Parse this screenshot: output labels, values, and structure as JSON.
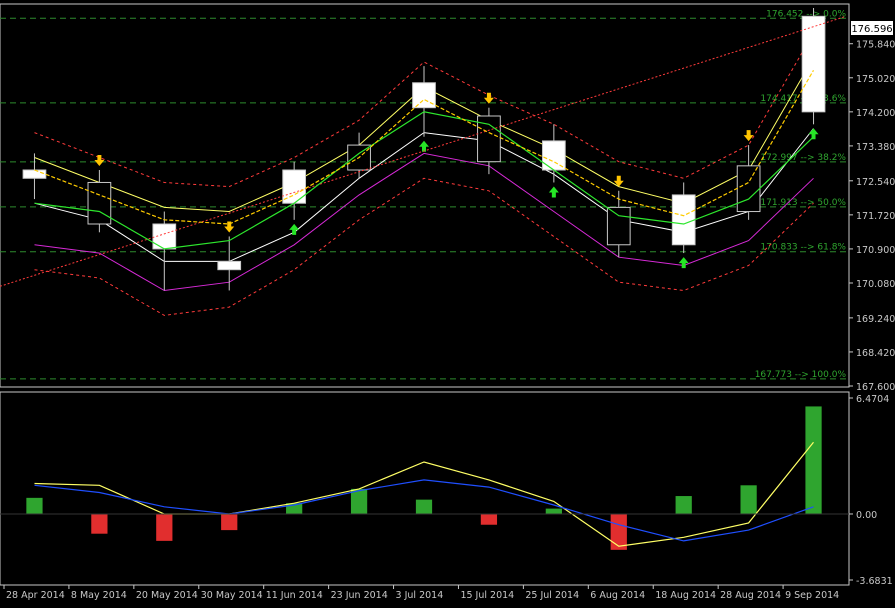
{
  "colors": {
    "background": "#000000",
    "axis": "#c8c8c8",
    "grid": "#2e8b2e",
    "fib_text": "#2fa52f",
    "candle_bull": "#ffffff",
    "candle_bear": "#000000",
    "candle_wick": "#c8c8c8",
    "bands_outer": "#ff3b3b",
    "bands_inner": "#ffff66",
    "ma_white": "#ffffff",
    "ma_magenta": "#d62ad6",
    "trend_green": "#2de62d",
    "trend_yellow": "#ffcc00",
    "arrow_up": "#26e626",
    "arrow_down": "#ffc400",
    "macd_pos": "#2fa52f",
    "macd_neg": "#e12e2e",
    "macd_signal": "#ffff66",
    "macd_main": "#1f4fff",
    "price_label_bg": "#ffffff",
    "price_label_fg": "#000000"
  },
  "price_panel": {
    "current_price": "176.596",
    "y_ticks": [
      "175.840",
      "175.020",
      "174.200",
      "173.380",
      "172.540",
      "171.720",
      "170.900",
      "170.080",
      "169.240",
      "168.420",
      "167.600"
    ],
    "fib_levels": [
      {
        "label": "176.452 --> 0.0%",
        "price": 176.452
      },
      {
        "label": "174.417 --> 23.6%",
        "price": 174.417
      },
      {
        "label": "172.997 --> 38.2%",
        "price": 172.997
      },
      {
        "label": "171.913 --> 50.0%",
        "price": 171.913
      },
      {
        "label": "170.833 --> 61.8%",
        "price": 170.833
      },
      {
        "label": "167.773 --> 100.0%",
        "price": 167.773
      }
    ]
  },
  "indicator_panel": {
    "y_ticks": [
      "6.4704",
      "0.00",
      "-3.6831"
    ]
  },
  "x_axis_labels": [
    "28 Apr 2014",
    "8 May 2014",
    "20 May 2014",
    "30 May 2014",
    "11 Jun 2014",
    "23 Jun 2014",
    "3 Jul 2014",
    "15 Jul 2014",
    "25 Jul 2014",
    "6 Aug 2014",
    "18 Aug 2014",
    "28 Aug 2014",
    "9 Sep 2014"
  ],
  "chart_data": [
    {
      "type": "line",
      "chart_style": "candlestick",
      "x_labels": [
        "28 Apr 2014",
        "8 May 2014",
        "20 May 2014",
        "30 May 2014",
        "11 Jun 2014",
        "23 Jun 2014",
        "3 Jul 2014",
        "15 Jul 2014",
        "25 Jul 2014",
        "6 Aug 2014",
        "18 Aug 2014",
        "28 Aug 2014",
        "9 Sep 2014"
      ],
      "ylim": [
        167.6,
        176.7
      ],
      "candles": [
        {
          "x": "28 Apr 2014",
          "o": 172.6,
          "h": 173.2,
          "l": 172.1,
          "c": 172.8
        },
        {
          "x": "8 May 2014",
          "o": 172.5,
          "h": 172.8,
          "l": 171.3,
          "c": 171.5
        },
        {
          "x": "20 May 2014",
          "o": 170.9,
          "h": 171.8,
          "l": 169.9,
          "c": 171.5
        },
        {
          "x": "30 May 2014",
          "o": 170.4,
          "h": 171.2,
          "l": 169.9,
          "c": 170.6
        },
        {
          "x": "11 Jun 2014",
          "o": 172.0,
          "h": 173.0,
          "l": 171.6,
          "c": 172.8
        },
        {
          "x": "23 Jun 2014",
          "o": 173.4,
          "h": 173.7,
          "l": 172.6,
          "c": 172.8
        },
        {
          "x": "3 Jul 2014",
          "o": 174.3,
          "h": 175.3,
          "l": 173.6,
          "c": 174.9
        },
        {
          "x": "15 Jul 2014",
          "o": 174.1,
          "h": 174.3,
          "l": 172.7,
          "c": 173.0
        },
        {
          "x": "25 Jul 2014",
          "o": 172.8,
          "h": 173.9,
          "l": 172.5,
          "c": 173.5
        },
        {
          "x": "6 Aug 2014",
          "o": 171.9,
          "h": 172.3,
          "l": 170.7,
          "c": 171.0
        },
        {
          "x": "18 Aug 2014",
          "o": 171.0,
          "h": 172.5,
          "l": 170.8,
          "c": 172.2
        },
        {
          "x": "28 Aug 2014",
          "o": 172.9,
          "h": 173.4,
          "l": 171.6,
          "c": 171.8
        },
        {
          "x": "9 Sep 2014",
          "o": 174.2,
          "h": 176.7,
          "l": 173.9,
          "c": 176.5
        }
      ],
      "series": [
        {
          "values": [
            173.1,
            172.5,
            171.9,
            171.8,
            172.5,
            173.4,
            174.8,
            174.0,
            173.3,
            172.4,
            172.0,
            172.8,
            175.5
          ]
        },
        {
          "values": [
            172.0,
            171.6,
            170.6,
            170.6,
            171.3,
            172.6,
            173.7,
            173.5,
            172.7,
            171.6,
            171.3,
            171.8,
            173.8
          ]
        },
        {
          "values": [
            171.0,
            170.8,
            169.9,
            170.1,
            171.0,
            172.2,
            173.2,
            172.9,
            171.8,
            170.7,
            170.5,
            171.1,
            172.6
          ]
        }
      ]
    },
    {
      "type": "bar",
      "x_labels": [
        "28 Apr 2014",
        "8 May 2014",
        "20 May 2014",
        "30 May 2014",
        "11 Jun 2014",
        "23 Jun 2014",
        "3 Jul 2014",
        "15 Jul 2014",
        "25 Jul 2014",
        "6 Aug 2014",
        "18 Aug 2014",
        "28 Aug 2014",
        "9 Sep 2014"
      ],
      "ylim": [
        -3.6831,
        6.4704
      ],
      "series": [
        {
          "name": "histogram",
          "values": [
            0.9,
            -1.1,
            -1.5,
            -0.9,
            0.6,
            1.4,
            0.8,
            -0.6,
            0.3,
            -2.0,
            1.0,
            1.6,
            6.0
          ]
        },
        {
          "name": "signal",
          "values": [
            1.7,
            1.6,
            0.0,
            0.0,
            0.6,
            1.4,
            2.9,
            1.9,
            0.7,
            -1.8,
            -1.3,
            -0.5,
            4.0
          ]
        },
        {
          "name": "main",
          "values": [
            1.6,
            1.2,
            0.4,
            0.0,
            0.5,
            1.3,
            1.9,
            1.5,
            0.5,
            -0.6,
            -1.5,
            -0.9,
            0.4
          ]
        }
      ]
    }
  ]
}
